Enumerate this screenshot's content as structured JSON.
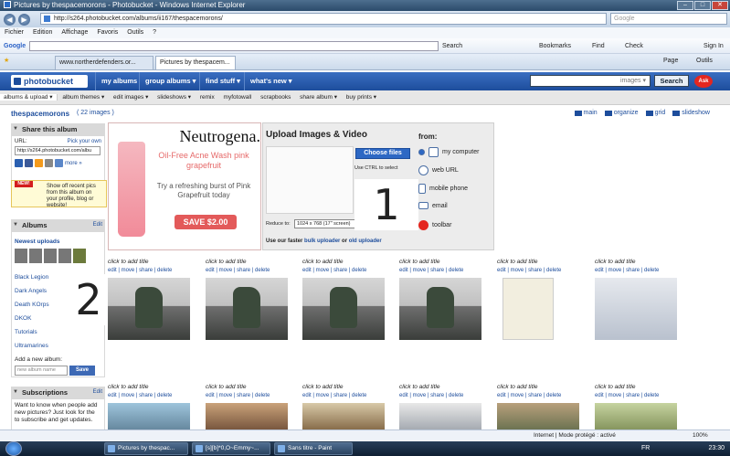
{
  "browser": {
    "window_title": "Pictures by thespacemorons - Photobucket - Windows Internet Explorer",
    "url": "http://s264.photobucket.com/albums/ii167/thespacemorons/",
    "search_placeholder": "Google",
    "menu": [
      "Fichier",
      "Edition",
      "Affichage",
      "Favoris",
      "Outils",
      "?"
    ],
    "google_toolbar": {
      "logo": "Google",
      "search": "Search",
      "bookmarks": "Bookmarks",
      "find": "Find",
      "check": "Check",
      "sign_in": "Sign In"
    },
    "tabs": [
      {
        "label": "www.northerdefenders.or..."
      },
      {
        "label": "Pictures by thespacem..."
      }
    ],
    "right_tools": {
      "page": "Page",
      "tools": "Outils"
    },
    "status": {
      "zone": "Internet | Mode protégé : activé",
      "zoom": "100%"
    }
  },
  "photobucket": {
    "logo": "photobucket",
    "nav": [
      "my albums",
      "group albums ▾",
      "find stuff ▾",
      "what's new ▾"
    ],
    "search_placeholder": "images ▾",
    "search_button": "Search",
    "brand_badge": "Ask",
    "subnav": [
      "albums & upload ▾",
      "album themes ▾",
      "edit images ▾",
      "slideshows ▾",
      "remix",
      "myfotowall",
      "scrapbooks",
      "share album ▾",
      "buy prints ▾"
    ],
    "album_title": "thespacemorons",
    "image_count": "( 22 images )",
    "view_modes": [
      "main",
      "organize",
      "grid",
      "slideshow"
    ]
  },
  "sidebar": {
    "share": {
      "title": "Share this album",
      "url_label": "URL:",
      "pick_own": "Pick your own",
      "url_value": "http://s264.photobucket.com/albu",
      "more": "more »"
    },
    "new_tag": "NEW!",
    "new_text": "Show off recent pics from this album on your profile, blog or website!",
    "albums": {
      "title": "Albums",
      "edit": "Edit",
      "newest": "Newest uploads",
      "list": [
        "Black Legion",
        "Dark Angels",
        "Death KOrps",
        "DKOK",
        "Tutorials",
        "Ultramarines"
      ],
      "add_label": "Add a new album:",
      "new_placeholder": "new album name",
      "save": "Save"
    },
    "subscriptions": {
      "title": "Subscriptions",
      "edit": "Edit",
      "text": "Want to know when people add new pictures? Just look for the  to subscribe and get updates."
    }
  },
  "ad": {
    "brand": "Neutrogena.",
    "line1": "Oil-Free Acne Wash pink grapefruit",
    "line2": "Try a refreshing burst of Pink Grapefruit today",
    "cta": "SAVE $2.00"
  },
  "upload": {
    "title": "Upload Images & Video",
    "choose": "Choose files",
    "ctrl_note": "Use CTRL to select",
    "reduce_label": "Reduce to:",
    "reduce_value": "1024 x 768 (17\" screen)",
    "fast_prefix": "Use our faster",
    "bulk": "bulk uploader",
    "or": "or",
    "old": "old uploader",
    "from_title": "from:",
    "sources": [
      "my computer",
      "web URL",
      "mobile phone",
      "email",
      "toolbar"
    ]
  },
  "annotations": {
    "one": "1",
    "two": "2"
  },
  "grid": {
    "title_prompt": "click to add title",
    "actions": "edit | move | share | delete"
  },
  "taskbar": {
    "items": [
      "Pictures by thespac...",
      "[s][b]*0,O~Emmy~...",
      "Sans titre - Paint"
    ],
    "lang": "FR",
    "clock": "23:30"
  }
}
